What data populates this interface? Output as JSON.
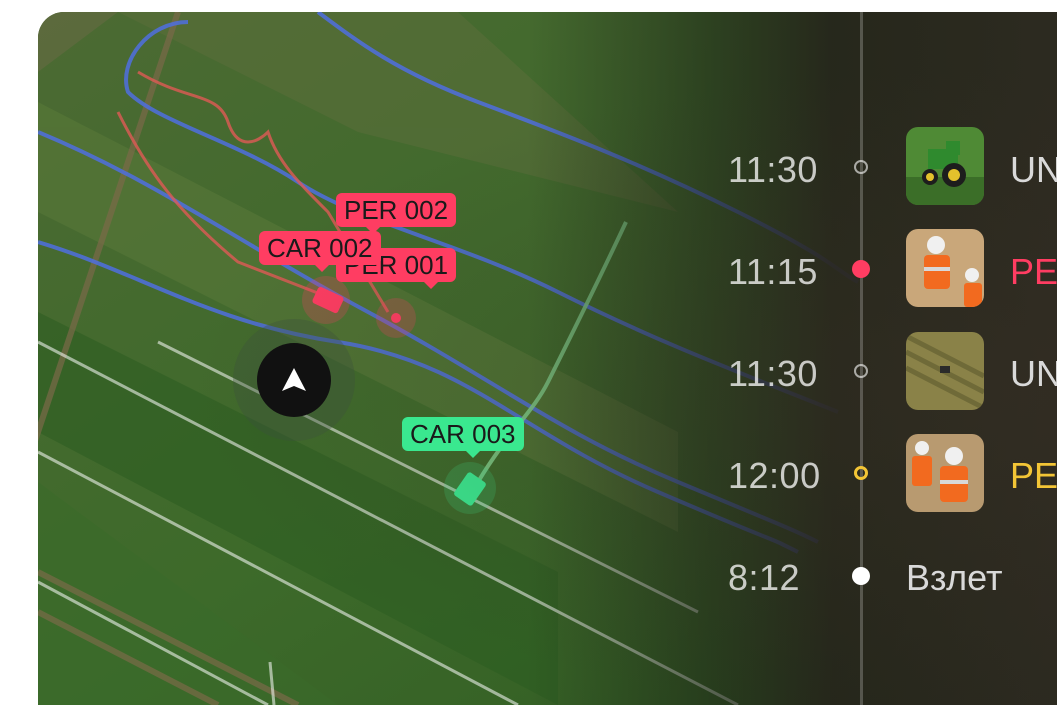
{
  "map": {
    "markers": [
      {
        "id": "per002",
        "label": "PER 002",
        "color": "#ff3d62"
      },
      {
        "id": "per001",
        "label": "PER 001",
        "color": "#ff3d62"
      },
      {
        "id": "car002",
        "label": "CAR 002",
        "color": "#ff3d62"
      },
      {
        "id": "car003",
        "label": "CAR 003",
        "color": "#3ae88f"
      }
    ],
    "location_button_icon": "navigation-arrow-icon"
  },
  "timeline": {
    "entries": [
      {
        "time": "11:30",
        "marker": "hollow",
        "thumbnail": "tractor-photo",
        "label": "UN",
        "label_color": "#d9d9d9"
      },
      {
        "time": "11:15",
        "marker": "red",
        "thumbnail": "workers-photo",
        "label": "PE",
        "label_color": "#ff3d62"
      },
      {
        "time": "11:30",
        "marker": "hollow",
        "thumbnail": "field-vehicle-photo",
        "label": "UN",
        "label_color": "#d9d9d9"
      },
      {
        "time": "12:00",
        "marker": "yellow",
        "thumbnail": "workers-photo-2",
        "label": "PE",
        "label_color": "#f3c536"
      },
      {
        "time": "8:12",
        "marker": "white",
        "thumbnail": "",
        "label": "Взлет",
        "label_color": "#d9d9d9"
      }
    ]
  },
  "colors": {
    "route_blue": "#4f6fe0",
    "route_red": "#e05a56",
    "route_green": "#7fcf8a",
    "alert_red": "#ff3d62",
    "ok_green": "#3ae88f",
    "warn_yellow": "#f3c536"
  }
}
